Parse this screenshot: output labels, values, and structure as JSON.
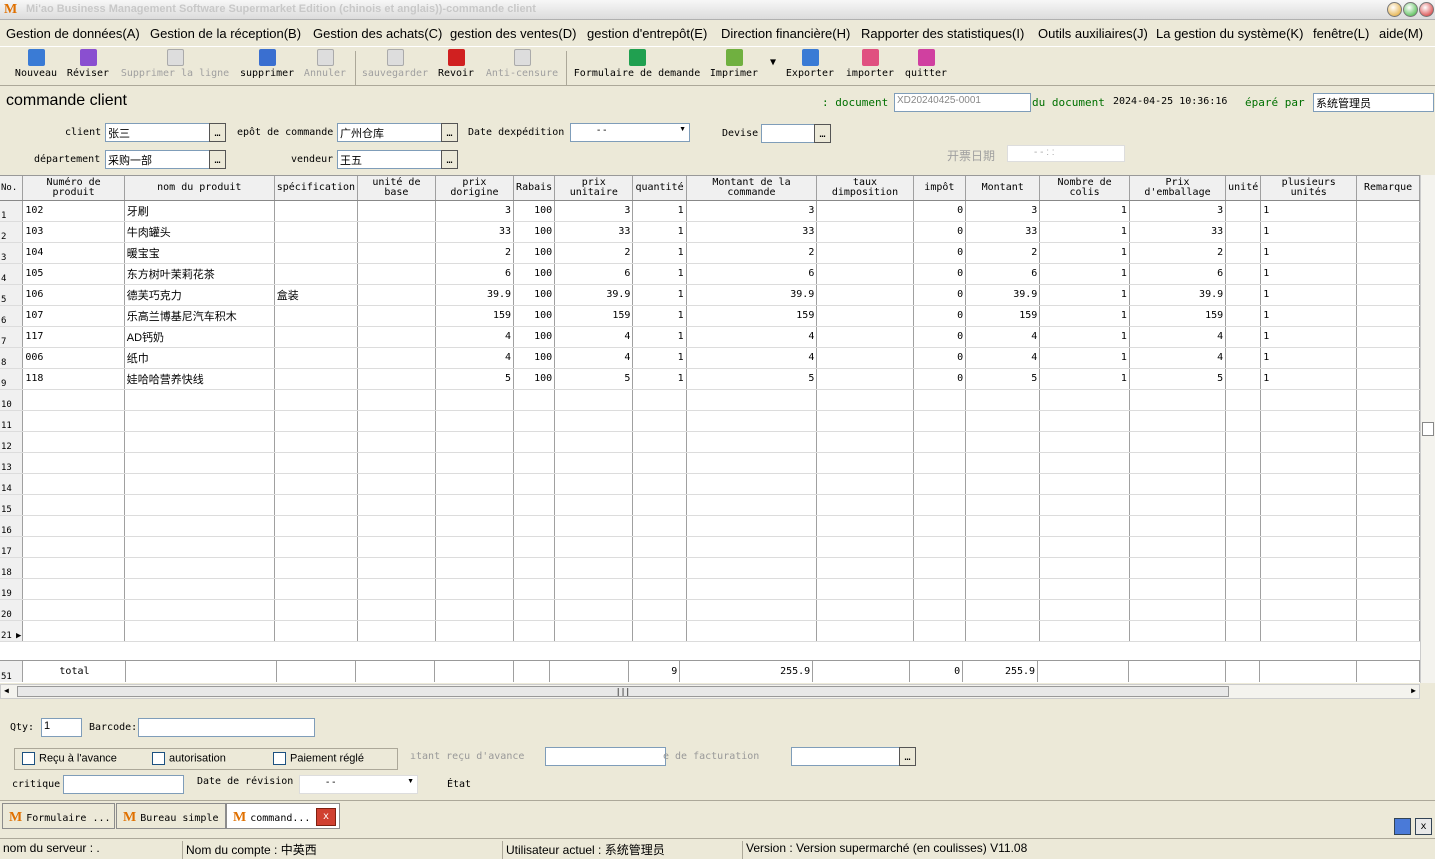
{
  "window": {
    "title": "Mi'ao Business Management Software Supermarket Edition (chinois et anglais))-commande client"
  },
  "menu": [
    "Gestion de données(A)",
    "Gestion de la réception(B)",
    "Gestion des achats(C)",
    "gestion des ventes(D)",
    "gestion d'entrepôt(E)",
    "Direction financière(H)",
    "Rapporter des statistiques(I)",
    "Outils auxiliaires(J)",
    "La gestion du système(K)",
    "fenêtre(L)",
    "aide(M)"
  ],
  "toolbar": [
    {
      "label": "Nouveau",
      "icon": "plus-icon",
      "enabled": true,
      "color": "#3a7bd5"
    },
    {
      "label": "Réviser",
      "icon": "edit-icon",
      "enabled": true,
      "color": "#8a4fd0"
    },
    {
      "label": "Supprimer la ligne",
      "icon": "delete-row-icon",
      "enabled": false
    },
    {
      "label": "supprimer",
      "icon": "trash-icon",
      "enabled": true,
      "color": "#3a6fd0"
    },
    {
      "label": "Annuler",
      "icon": "undo-icon",
      "enabled": false
    },
    {
      "label": "sauvegarder",
      "icon": "save-icon",
      "enabled": false
    },
    {
      "label": "Revoir",
      "icon": "check-icon",
      "enabled": true,
      "color": "#d02020"
    },
    {
      "label": "Anti-censure",
      "icon": "user-icon",
      "enabled": false
    },
    {
      "label": "Formulaire de demande",
      "icon": "search-icon",
      "enabled": true,
      "color": "#20a050"
    },
    {
      "label": "Imprimer",
      "icon": "printer-icon",
      "enabled": true,
      "color": "#70b040"
    },
    {
      "label": "Exporter",
      "icon": "export-icon",
      "enabled": true,
      "color": "#3a7bd5"
    },
    {
      "label": "importer",
      "icon": "import-icon",
      "enabled": true,
      "color": "#e05080"
    },
    {
      "label": "quitter",
      "icon": "power-icon",
      "enabled": true,
      "color": "#d040a0"
    }
  ],
  "form": {
    "title": "commande client",
    "doc_no_label": ": document",
    "doc_no": "XD20240425-0001",
    "doc_date_label": "du document",
    "doc_date": "2024-04-25 10:36:16",
    "prepared_label": "éparé par",
    "prepared_by": "系统管理员",
    "client_label": "client",
    "client": "张三",
    "warehouse_label": "epôt de commande",
    "warehouse": "广州仓库",
    "ship_date_label": "Date dexpédition",
    "ship_date": "-  -",
    "currency_label": "Devise",
    "currency": "",
    "dept_label": "département",
    "dept": "采购一部",
    "seller_label": "vendeur",
    "seller": "王五",
    "invoice_date_label": "开票日期",
    "invoice_date": "-  -      :  :"
  },
  "grid": {
    "headers": [
      "No.",
      "Numéro de produit",
      "nom du produit",
      "spécification",
      "unité de base",
      "prix dorigine",
      "Rabais",
      "prix unitaire",
      "quantité",
      "Montant de la commande",
      "taux dimposition",
      "impôt",
      "Montant",
      "Nombre de colis",
      "Prix d'emballage",
      "unité",
      "plusieurs unités",
      "Remarque"
    ],
    "rows": [
      [
        "1",
        "102",
        "牙刷",
        "",
        "",
        "3",
        "100",
        "3",
        "1",
        "3",
        "",
        "0",
        "3",
        "1",
        "3",
        "",
        "1",
        ""
      ],
      [
        "2",
        "103",
        "牛肉罐头",
        "",
        "",
        "33",
        "100",
        "33",
        "1",
        "33",
        "",
        "0",
        "33",
        "1",
        "33",
        "",
        "1",
        ""
      ],
      [
        "3",
        "104",
        "暖宝宝",
        "",
        "",
        "2",
        "100",
        "2",
        "1",
        "2",
        "",
        "0",
        "2",
        "1",
        "2",
        "",
        "1",
        ""
      ],
      [
        "4",
        "105",
        "东方树叶茉莉花茶",
        "",
        "",
        "6",
        "100",
        "6",
        "1",
        "6",
        "",
        "0",
        "6",
        "1",
        "6",
        "",
        "1",
        ""
      ],
      [
        "5",
        "106",
        "德芙巧克力",
        "盒装",
        "",
        "39.9",
        "100",
        "39.9",
        "1",
        "39.9",
        "",
        "0",
        "39.9",
        "1",
        "39.9",
        "",
        "1",
        ""
      ],
      [
        "6",
        "107",
        "乐高兰博基尼汽车积木",
        "",
        "",
        "159",
        "100",
        "159",
        "1",
        "159",
        "",
        "0",
        "159",
        "1",
        "159",
        "",
        "1",
        ""
      ],
      [
        "7",
        "117",
        "AD钙奶",
        "",
        "",
        "4",
        "100",
        "4",
        "1",
        "4",
        "",
        "0",
        "4",
        "1",
        "4",
        "",
        "1",
        ""
      ],
      [
        "8",
        "006",
        "纸巾",
        "",
        "",
        "4",
        "100",
        "4",
        "1",
        "4",
        "",
        "0",
        "4",
        "1",
        "4",
        "",
        "1",
        ""
      ],
      [
        "9",
        "118",
        "娃哈哈营养快线",
        "",
        "",
        "5",
        "100",
        "5",
        "1",
        "5",
        "",
        "0",
        "5",
        "1",
        "5",
        "",
        "1",
        ""
      ]
    ],
    "empty_row_numbers": [
      "10",
      "11",
      "12",
      "13",
      "14",
      "15",
      "16",
      "17",
      "18",
      "19",
      "20",
      "21"
    ],
    "total": {
      "row_no": "51",
      "label": "total",
      "quantity": "9",
      "amount": "255.9",
      "tax": "0",
      "montant": "255.9"
    }
  },
  "bottom": {
    "qty_label": "Qty:",
    "qty": "1",
    "barcode_label": "Barcode:",
    "barcode": "",
    "chk_advance": "Reçu à l'avance",
    "chk_auth": "autorisation",
    "chk_paid": "Paiement réglé",
    "advance_amount_label": "ıtant reçu d'avance",
    "billing_label": "e de facturation",
    "critique_label": "critique",
    "revision_label": "Date de révision",
    "revision_date": "-  -",
    "etat_label": "État"
  },
  "tabs": [
    "Formulaire ...",
    "Bureau simple",
    "command..."
  ],
  "status": {
    "server": "nom du serveur : .",
    "account": "Nom du compte : 中英西",
    "user": "Utilisateur actuel : 系统管理员",
    "version": "Version : Version supermarché (en coulisses) V11.08"
  }
}
